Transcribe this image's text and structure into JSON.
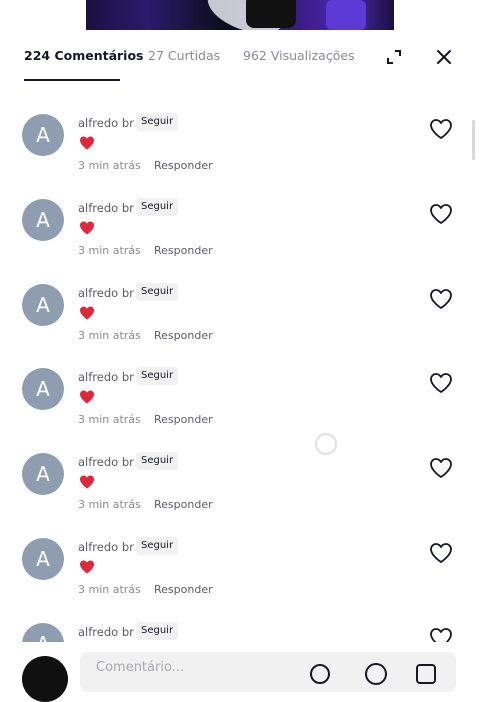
{
  "tabs": {
    "comments": "224 Comentários",
    "likes": "27 Curtidas",
    "views": "962 Visualizações"
  },
  "icons": {
    "expand": "expand-icon",
    "close": "close-icon",
    "like": "heart-outline-icon",
    "emoji_heart": "red-heart-emoji",
    "mention": "at-icon",
    "gif": "gif-icon"
  },
  "colors": {
    "avatar_bg": "#8e9db0",
    "heart_red": "#e0283c",
    "active_tab": "#161823",
    "muted": "#8a8b91"
  },
  "comments": [
    {
      "avatar_letter": "A",
      "username": "alfredo br",
      "follow": "Seguir",
      "time": "3 min atrás",
      "reply": "Responder"
    },
    {
      "avatar_letter": "A",
      "username": "alfredo br",
      "follow": "Seguir",
      "time": "3 min atrás",
      "reply": "Responder"
    },
    {
      "avatar_letter": "A",
      "username": "alfredo br",
      "follow": "Seguir",
      "time": "3 min atrás",
      "reply": "Responder"
    },
    {
      "avatar_letter": "A",
      "username": "alfredo br",
      "follow": "Seguir",
      "time": "3 min atrás",
      "reply": "Responder"
    },
    {
      "avatar_letter": "A",
      "username": "alfredo br",
      "follow": "Seguir",
      "time": "3 min atrás",
      "reply": "Responder"
    },
    {
      "avatar_letter": "A",
      "username": "alfredo br",
      "follow": "Seguir",
      "time": "3 min atrás",
      "reply": "Responder"
    },
    {
      "avatar_letter": "A",
      "username": "alfredo br",
      "follow": "Seguir",
      "time": "",
      "reply": ""
    }
  ],
  "composer": {
    "placeholder": "Comentário..."
  }
}
